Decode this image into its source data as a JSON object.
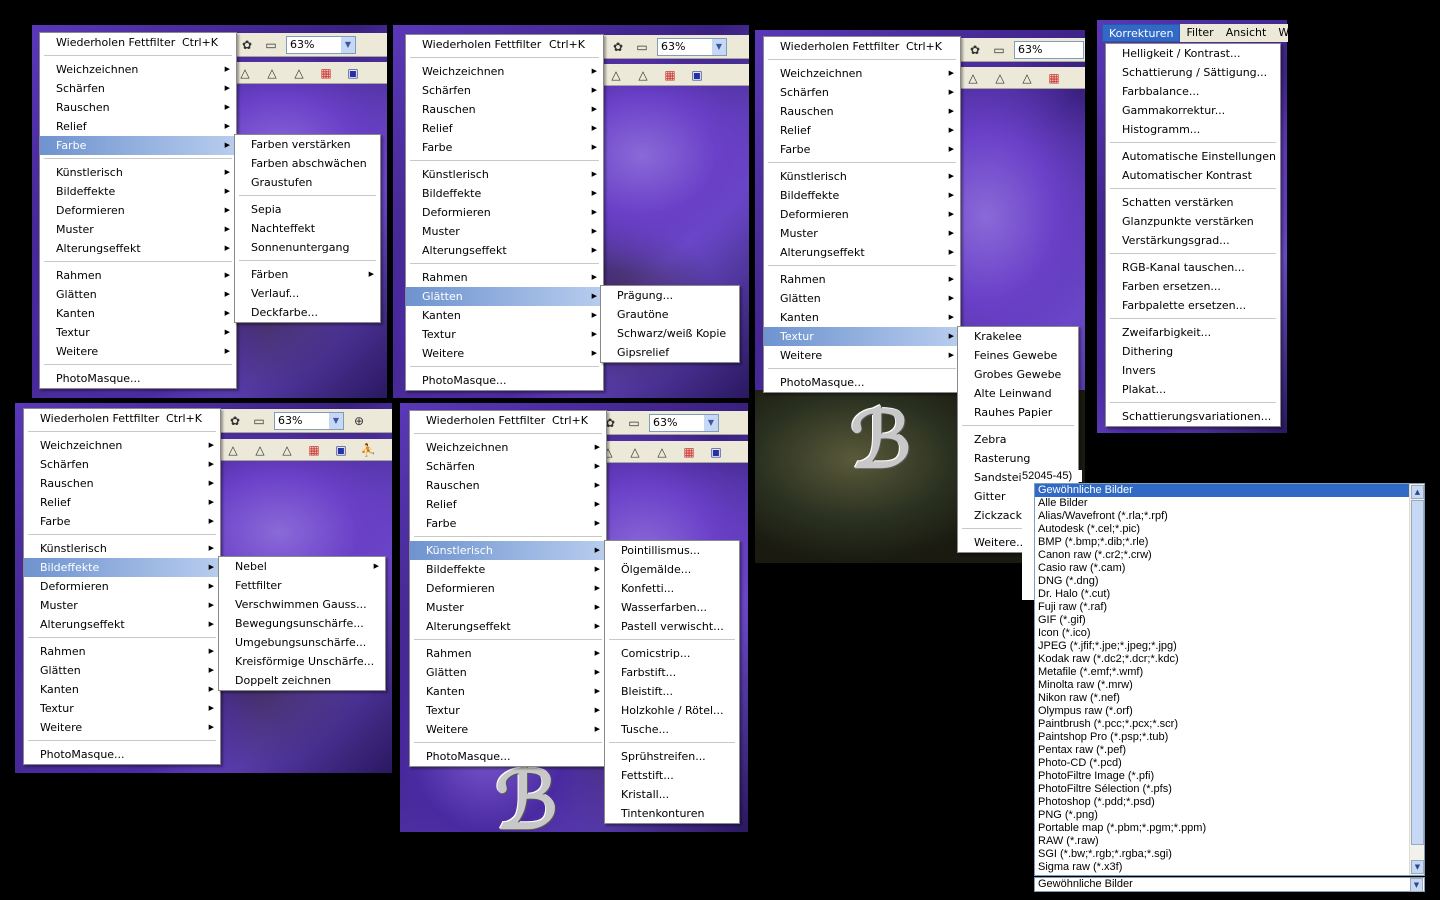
{
  "filter_menu": {
    "repeat": "Wiederholen Fettfilter",
    "shortcut": "Ctrl+K",
    "items": [
      "Weichzeichnen",
      "Schärfen",
      "Rauschen",
      "Relief",
      "Farbe",
      "Künstlerisch",
      "Bildeffekte",
      "Deformieren",
      "Muster",
      "Alterungseffekt",
      "Rahmen",
      "Glätten",
      "Kanten",
      "Textur",
      "Weitere"
    ],
    "photomasque": "PhotoMasque..."
  },
  "zoom": "63%",
  "farbe_sub": [
    "Farben verstärken",
    "Farben abschwächen",
    "Graustufen",
    "Sepia",
    "Nachteffekt",
    "Sonnenuntergang",
    "Färben",
    "Verlauf...",
    "Deckfarbe..."
  ],
  "glaetten_sub": [
    "Prägung...",
    "Grautöne",
    "Schwarz/weiß Kopie",
    "Gipsrelief"
  ],
  "textur_sub": [
    "Krakelee",
    "Feines Gewebe",
    "Grobes Gewebe",
    "Alte Leinwand",
    "Rauhes Papier",
    "Zebra",
    "Rasterung",
    "Sandstein",
    "Gitter",
    "Zickzack",
    "Weitere..."
  ],
  "bildeffekte_sub": [
    "Nebel",
    "Fettfilter",
    "Verschwimmen Gauss...",
    "Bewegungsunschärfe...",
    "Umgebungsunschärfe...",
    "Kreisförmige Unschärfe...",
    "Doppelt zeichnen"
  ],
  "kuenstlerisch_sub": [
    "Pointillismus...",
    "Ölgemälde...",
    "Konfetti...",
    "Wasserfarben...",
    "Pastell verwischt...",
    "Comicstrip...",
    "Farbstift...",
    "Bleistift...",
    "Holzkohle / Rötel...",
    "Tusche...",
    "Sprühstreifen...",
    "Fettstift...",
    "Kristall...",
    "Tintenkonturen"
  ],
  "menubar": [
    "Korrekturen",
    "Filter",
    "Ansicht",
    "Werkz"
  ],
  "korrekturen": [
    "Helligkeit / Kontrast...",
    "Schattierung / Sättigung...",
    "Farbbalance...",
    "Gammakorrektur...",
    "Histogramm...",
    "Automatische Einstellungen",
    "Automatischer Kontrast",
    "Schatten verstärken",
    "Glanzpunkte verstärken",
    "Verstärkungsgrad...",
    "RGB-Kanal tauschen...",
    "Farben ersetzen...",
    "Farbpalette ersetzen...",
    "Zweifarbigkeit...",
    "Dithering",
    "Invers",
    "Plakat...",
    "Schattierungsvariationen..."
  ],
  "file_types": [
    "Gewöhnliche Bilder",
    "Alle Bilder",
    "Alias/Wavefront (*.rla;*.rpf)",
    "Autodesk (*.cel;*.pic)",
    "BMP (*.bmp;*.dib;*.rle)",
    "Canon raw (*.cr2;*.crw)",
    "Casio raw (*.cam)",
    "DNG (*.dng)",
    "Dr. Halo (*.cut)",
    "Fuji raw (*.raf)",
    "GIF (*.gif)",
    "Icon (*.ico)",
    "JPEG (*.jfif;*.jpe;*.jpeg;*.jpg)",
    "Kodak raw (*.dc2;*.dcr;*.kdc)",
    "Metafile (*.emf;*.wmf)",
    "Minolta raw (*.mrw)",
    "Nikon raw (*.nef)",
    "Olympus raw (*.orf)",
    "Paintbrush (*.pcc;*.pcx;*.scr)",
    "Paintshop Pro (*.psp;*.tub)",
    "Pentax raw (*.pef)",
    "Photo-CD (*.pcd)",
    "PhotoFiltre Image (*.pfi)",
    "PhotoFiltre Sélection (*.pfs)",
    "Photoshop (*.pdd;*.psd)",
    "PNG (*.png)",
    "Portable map (*.pbm;*.pgm;*.ppm)",
    "RAW (*.raw)",
    "SGI (*.bw;*.rgb;*.rgba;*.sgi)",
    "Sigma raw (*.x3f)"
  ],
  "file_type_selected": "Gewöhnliche Bilder",
  "behind_text": "52045-45)"
}
